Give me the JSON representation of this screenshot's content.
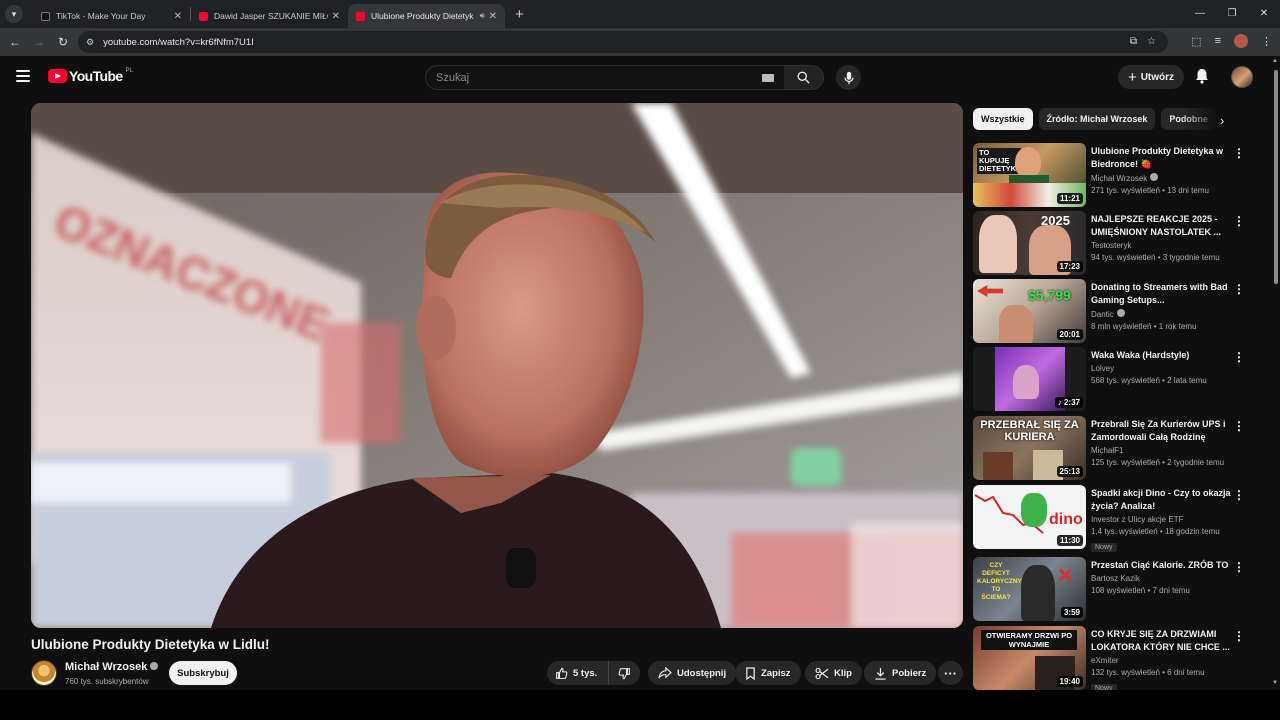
{
  "browser": {
    "tabs": [
      {
        "title": "TikTok - Make Your Day",
        "favicon": "tiktok-icon",
        "active": false
      },
      {
        "title": "Dawid Jasper SZUKANIE MIŁOŚ",
        "favicon": "youtube-icon",
        "active": false
      },
      {
        "title": "Ulubione Produkty Dietetyk",
        "favicon": "youtube-icon",
        "active": true,
        "audio": true
      }
    ],
    "url": "youtube.com/watch?v=kr6fNfm7U1I"
  },
  "header": {
    "logo_text": "YouTube",
    "country_code": "PL",
    "search_placeholder": "Szukaj",
    "create_label": "Utwórz"
  },
  "video": {
    "title": "Ulubione Produkty Dietetyka w Lidlu!",
    "channel": "Michał Wrzosek",
    "subscribers": "760 tys. subskrybentów",
    "subscribe_label": "Subskrybuj",
    "likes": "5 tys.",
    "share_label": "Udostępnij",
    "save_label": "Zapisz",
    "clip_label": "Klip",
    "download_label": "Pobierz",
    "frame_sign_text": "OZNACZONE"
  },
  "chips": [
    "Wszystkie",
    "Źródło: Michał Wrzosek",
    "Podobne"
  ],
  "recommendations": [
    {
      "title": "Ulubione Produkty Dietetyka w Biedronce! 🍓",
      "channel": "Michał Wrzosek",
      "verified": true,
      "meta": "271 tys. wyświetleń • 13 dni temu",
      "duration": "11:21",
      "thumb_text": "TO KUPUJĘ DIETETYK!",
      "badge": ""
    },
    {
      "title": "NAJLEPSZE REAKCJE 2025 - UMIĘŚNIONY NASTOLATEK ...",
      "channel": "Testosteryk",
      "verified": false,
      "meta": "94 tys. wyświetleń • 3 tygodnie temu",
      "duration": "17:23",
      "thumb_text": "2025",
      "badge": ""
    },
    {
      "title": "Donating to Streamers with Bad Gaming Setups...",
      "channel": "Dantic",
      "verified": true,
      "meta": "8 mln wyświetleń • 1 rok temu",
      "duration": "20:01",
      "thumb_text": "$5,799",
      "badge": ""
    },
    {
      "title": "Waka Waka (Hardstyle)",
      "channel": "Loivey",
      "verified": false,
      "meta": "568 tys. wyświetleń • 2 lata temu",
      "duration": "2:37",
      "thumb_text": "",
      "badge": ""
    },
    {
      "title": "Przebrali Się Za Kurierów UPS i Zamordowali Całą Rodzinę",
      "channel": "MichałF1",
      "verified": false,
      "meta": "125 tys. wyświetleń • 2 tygodnie temu",
      "duration": "25:13",
      "thumb_text": "PRZEBRAŁ SIĘ ZA KURIERA",
      "badge": ""
    },
    {
      "title": "Spadki akcji Dino - Czy to okazja życia? Analiza!",
      "channel": "Investor z Ulicy akcje ETF",
      "verified": false,
      "meta": "1,4 tys. wyświetleń • 18 godzin temu",
      "duration": "11:30",
      "thumb_text": "dino",
      "badge": "Nowy"
    },
    {
      "title": "Przestań Ciąć Kalorie. ZRÓB TO",
      "channel": "Bartosz Kazik",
      "verified": false,
      "meta": "108 wyświetleń • 7 dni temu",
      "duration": "3:59",
      "thumb_text": "CZY DEFICYT KALORYCZNY TO ŚCIEMA?",
      "badge": ""
    },
    {
      "title": "CO KRYJE SIĘ ZA DRZWIAMI LOKATORA KTÓRY NIE CHCE ...",
      "channel": "eXmiter",
      "verified": false,
      "meta": "132 tys. wyświetleń • 6 dni temu",
      "duration": "19:40",
      "thumb_text": "OTWIERAMY DRZWI PO WYNAJMIE",
      "badge": "Nowy"
    }
  ],
  "colors": {
    "background": "#0f0f0f",
    "accent": "#ff0033",
    "pill": "#272727"
  }
}
